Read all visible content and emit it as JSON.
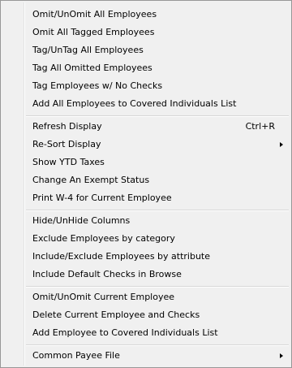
{
  "menu": {
    "items": [
      {
        "label": "Omit/UnOmit All Employees"
      },
      {
        "label": "Omit All Tagged Employees"
      },
      {
        "label": "Tag/UnTag All Employees"
      },
      {
        "label": "Tag All Omitted Employees"
      },
      {
        "label": "Tag Employees w/ No Checks"
      },
      {
        "label": "Add All Employees to Covered Individuals List"
      },
      {
        "label": "Refresh Display",
        "shortcut": "Ctrl+R"
      },
      {
        "label": "Re-Sort Display",
        "submenu": true
      },
      {
        "label": "Show YTD Taxes"
      },
      {
        "label": "Change An Exempt Status"
      },
      {
        "label": "Print W-4 for Current Employee"
      },
      {
        "label": "Hide/UnHide Columns"
      },
      {
        "label": "Exclude Employees by category"
      },
      {
        "label": "Include/Exclude Employees by attribute"
      },
      {
        "label": "Include Default Checks in Browse"
      },
      {
        "label": "Omit/UnOmit Current Employee"
      },
      {
        "label": "Delete Current Employee and Checks"
      },
      {
        "label": "Add Employee to Covered Individuals List"
      },
      {
        "label": "Common Payee File",
        "submenu": true
      }
    ]
  }
}
